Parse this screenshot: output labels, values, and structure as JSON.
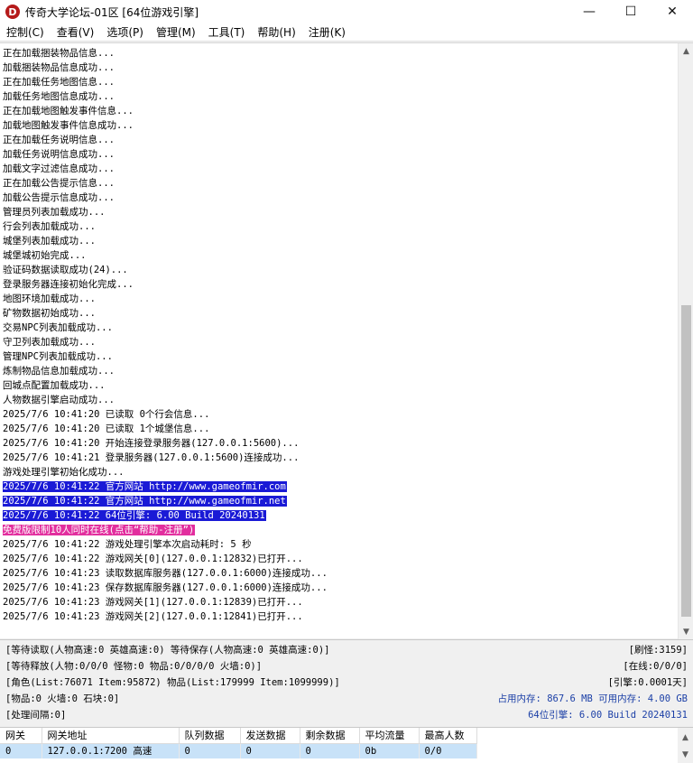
{
  "window": {
    "icon_letter": "D",
    "title": "传奇大学论坛-01区 [64位游戏引擎]",
    "controls": {
      "minimize": "—",
      "maximize": "☐",
      "close": "✕"
    }
  },
  "menu": [
    {
      "label": "控制(C)"
    },
    {
      "label": "查看(V)"
    },
    {
      "label": "选项(P)"
    },
    {
      "label": "管理(M)"
    },
    {
      "label": "工具(T)"
    },
    {
      "label": "帮助(H)"
    },
    {
      "label": "注册(K)"
    }
  ],
  "log": [
    {
      "text": "正在加载捆装物品信息...",
      "style": ""
    },
    {
      "text": "加载捆装物品信息成功...",
      "style": ""
    },
    {
      "text": "正在加载任务地图信息...",
      "style": ""
    },
    {
      "text": "加载任务地图信息成功...",
      "style": ""
    },
    {
      "text": "正在加载地图触发事件信息...",
      "style": ""
    },
    {
      "text": "加载地图触发事件信息成功...",
      "style": ""
    },
    {
      "text": "正在加载任务说明信息...",
      "style": ""
    },
    {
      "text": "加载任务说明信息成功...",
      "style": ""
    },
    {
      "text": "加载文字过滤信息成功...",
      "style": ""
    },
    {
      "text": "正在加载公告提示信息...",
      "style": ""
    },
    {
      "text": "加载公告提示信息成功...",
      "style": ""
    },
    {
      "text": "管理员列表加载成功...",
      "style": ""
    },
    {
      "text": "行会列表加载成功...",
      "style": ""
    },
    {
      "text": "城堡列表加载成功...",
      "style": ""
    },
    {
      "text": "城堡城初始完成...",
      "style": ""
    },
    {
      "text": "验证码数据读取成功(24)...",
      "style": ""
    },
    {
      "text": "登录服务器连接初始化完成...",
      "style": ""
    },
    {
      "text": "地图环境加载成功...",
      "style": ""
    },
    {
      "text": "矿物数据初始成功...",
      "style": ""
    },
    {
      "text": "交易NPC列表加载成功...",
      "style": ""
    },
    {
      "text": "守卫列表加载成功...",
      "style": ""
    },
    {
      "text": "管理NPC列表加载成功...",
      "style": ""
    },
    {
      "text": "炼制物品信息加载成功...",
      "style": ""
    },
    {
      "text": "回城点配置加载成功...",
      "style": ""
    },
    {
      "text": "人物数据引擎启动成功...",
      "style": ""
    },
    {
      "text": "2025/7/6 10:41:20 已读取 0个行会信息...",
      "style": ""
    },
    {
      "text": "2025/7/6 10:41:20 已读取 1个城堡信息...",
      "style": ""
    },
    {
      "text": "2025/7/6 10:41:20 开始连接登录服务器(127.0.0.1:5600)...",
      "style": ""
    },
    {
      "text": "2025/7/6 10:41:21 登录服务器(127.0.0.1:5600)连接成功...",
      "style": ""
    },
    {
      "text": "游戏处理引擎初始化成功...",
      "style": ""
    },
    {
      "text": "2025/7/6 10:41:22 官方网站 http://www.gameofmir.com",
      "style": "hl-blue"
    },
    {
      "text": "2025/7/6 10:41:22 官方网站 http://www.gameofmir.net",
      "style": "hl-blue"
    },
    {
      "text": "2025/7/6 10:41:22 64位引擎: 6.00 Build 20240131",
      "style": "hl-blue"
    },
    {
      "text": "免费版限制10人同时在线(点击“帮助-注册”)",
      "style": "hl-pink"
    },
    {
      "text": "2025/7/6 10:41:22 游戏处理引擎本次启动耗时: 5 秒",
      "style": ""
    },
    {
      "text": "2025/7/6 10:41:22 游戏网关[0](127.0.0.1:12832)已打开...",
      "style": ""
    },
    {
      "text": "2025/7/6 10:41:23 读取数据库服务器(127.0.0.1:6000)连接成功...",
      "style": ""
    },
    {
      "text": "2025/7/6 10:41:23 保存数据库服务器(127.0.0.1:6000)连接成功...",
      "style": ""
    },
    {
      "text": "2025/7/6 10:41:23 游戏网关[1](127.0.0.1:12839)已打开...",
      "style": ""
    },
    {
      "text": "2025/7/6 10:41:23 游戏网关[2](127.0.0.1:12841)已打开...",
      "style": ""
    }
  ],
  "status": {
    "row1_left": "[等待读取(人物高速:0 英雄高速:0) 等待保存(人物高速:0 英雄高速:0)]",
    "row1_right": "[刷怪:3159]",
    "row2_left": "[等待释放(人物:0/0/0 怪物:0 物品:0/0/0/0 火墙:0)]",
    "row2_right": "[在线:0/0/0]",
    "row3_left": "[角色(List:76071 Item:95872) 物品(List:179999 Item:1099999)]",
    "row3_right": "[引擎:0.0001天]",
    "row4_left": "[物品:0 火墙:0 石块:0]",
    "row4_right": "占用内存: 867.6 MB 可用内存: 4.00 GB",
    "row5_left": "[处理间隔:0]",
    "row5_right": "64位引擎: 6.00 Build 20240131"
  },
  "gateway_table": {
    "columns": [
      "网关",
      "网关地址",
      "队列数据",
      "发送数据",
      "剩余数据",
      "平均流量",
      "最高人数"
    ],
    "rows": [
      [
        "0",
        "127.0.0.1:7200 高速",
        "0",
        "0",
        "0",
        "0b",
        "0/0"
      ]
    ]
  },
  "colors": {
    "highlight_blue": "#1a1ad6",
    "highlight_pink": "#e22e9e",
    "status_blue_text": "#1b3fa6",
    "selected_row": "#c8e2f8"
  }
}
